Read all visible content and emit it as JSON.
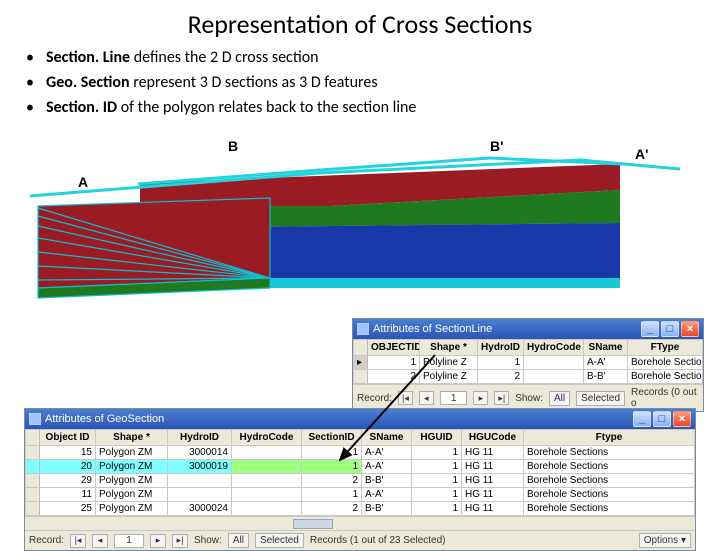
{
  "title": "Representation of Cross Sections",
  "bullets": [
    {
      "b": "Section. Line",
      "rest": " defines the 2 D cross section"
    },
    {
      "b": "Geo. Section",
      "rest": " represent 3 D sections as 3 D features"
    },
    {
      "b": "Section. ID",
      "rest": " of the polygon relates back to the section line"
    }
  ],
  "labels": {
    "A": "A",
    "Ap": "A'",
    "B": "B",
    "Bp": "B'"
  },
  "win1": {
    "title": "Attributes of SectionLine",
    "columns": [
      "OBJECTID",
      "Shape *",
      "HydroID",
      "HydroCode",
      "SName",
      "FType"
    ],
    "rows": [
      [
        "1",
        "Polyline Z",
        "1",
        "",
        "A-A'",
        "Borehole Section"
      ],
      [
        "2",
        "Polyline Z",
        "2",
        "",
        "B-B'",
        "Borehole Section"
      ]
    ],
    "status": {
      "record_lbl": "Record:",
      "rec": "1",
      "show_lbl": "Show:",
      "all": "All",
      "selected": "Selected",
      "summary": "Records (0 out o"
    }
  },
  "win2": {
    "title": "Attributes of GeoSection",
    "columns": [
      "Object ID",
      "Shape *",
      "HydroID",
      "HydroCode",
      "SectionID",
      "SName",
      "HGUID",
      "HGUCode",
      "Ftype"
    ],
    "rows": [
      [
        "15",
        "Polygon ZM",
        "3000014",
        "",
        "1",
        "A-A'",
        "1",
        "HG 11",
        "Borehole Sections"
      ],
      [
        "20",
        "Polygon ZM",
        "3000019",
        "",
        "1",
        "A-A'",
        "1",
        "HG 11",
        "Borehole Sections"
      ],
      [
        "29",
        "Polygon ZM",
        "",
        "",
        "2",
        "B-B'",
        "1",
        "HG 11",
        "Borehole Sections"
      ],
      [
        "11",
        "Polygon ZM",
        "",
        "",
        "1",
        "A-A'",
        "1",
        "HG 11",
        "Borehole Sections"
      ],
      [
        "25",
        "Polygon ZM",
        "3000024",
        "",
        "2",
        "B-B'",
        "1",
        "HG 11",
        "Borehole Sections"
      ]
    ],
    "status": {
      "record_lbl": "Record:",
      "rec": "1",
      "show_lbl": "Show:",
      "all": "All",
      "selected": "Selected",
      "summary": "Records (1 out of 23 Selected)",
      "options": "Options"
    }
  },
  "icons": {
    "min": "_",
    "max": "□",
    "close": "×",
    "first": "|◂",
    "prev": "◂",
    "next": "▸",
    "last": "▸|",
    "dd": "▾"
  }
}
